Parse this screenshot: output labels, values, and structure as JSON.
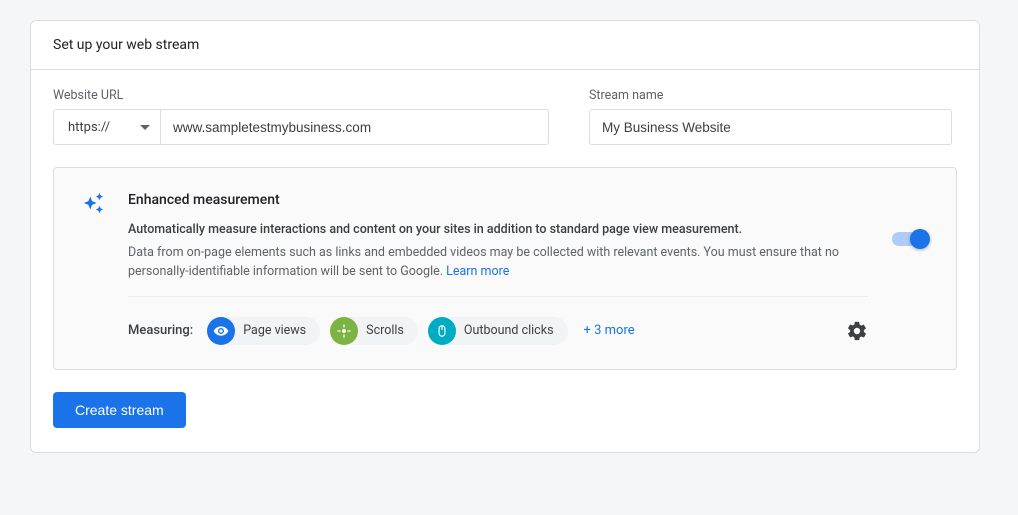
{
  "header": {
    "title": "Set up your web stream"
  },
  "fields": {
    "url_label": "Website URL",
    "protocol": "https://",
    "url_value": "www.sampletestmybusiness.com",
    "stream_label": "Stream name",
    "stream_value": "My Business Website"
  },
  "enhanced": {
    "title": "Enhanced measurement",
    "line1": "Automatically measure interactions and content on your sites in addition to standard page view measurement.",
    "line2": "Data from on-page elements such as links and embedded videos may be collected with relevant events. You must ensure that no personally-identifiable information will be sent to Google. ",
    "learn_more": "Learn more",
    "toggle_on": true
  },
  "measuring": {
    "label": "Measuring:",
    "chips": [
      {
        "label": "Page views",
        "color": "blue",
        "icon": "eye"
      },
      {
        "label": "Scrolls",
        "color": "green",
        "icon": "scroll"
      },
      {
        "label": "Outbound clicks",
        "color": "cyan",
        "icon": "mouse"
      }
    ],
    "more": "+ 3 more"
  },
  "actions": {
    "create": "Create stream"
  }
}
